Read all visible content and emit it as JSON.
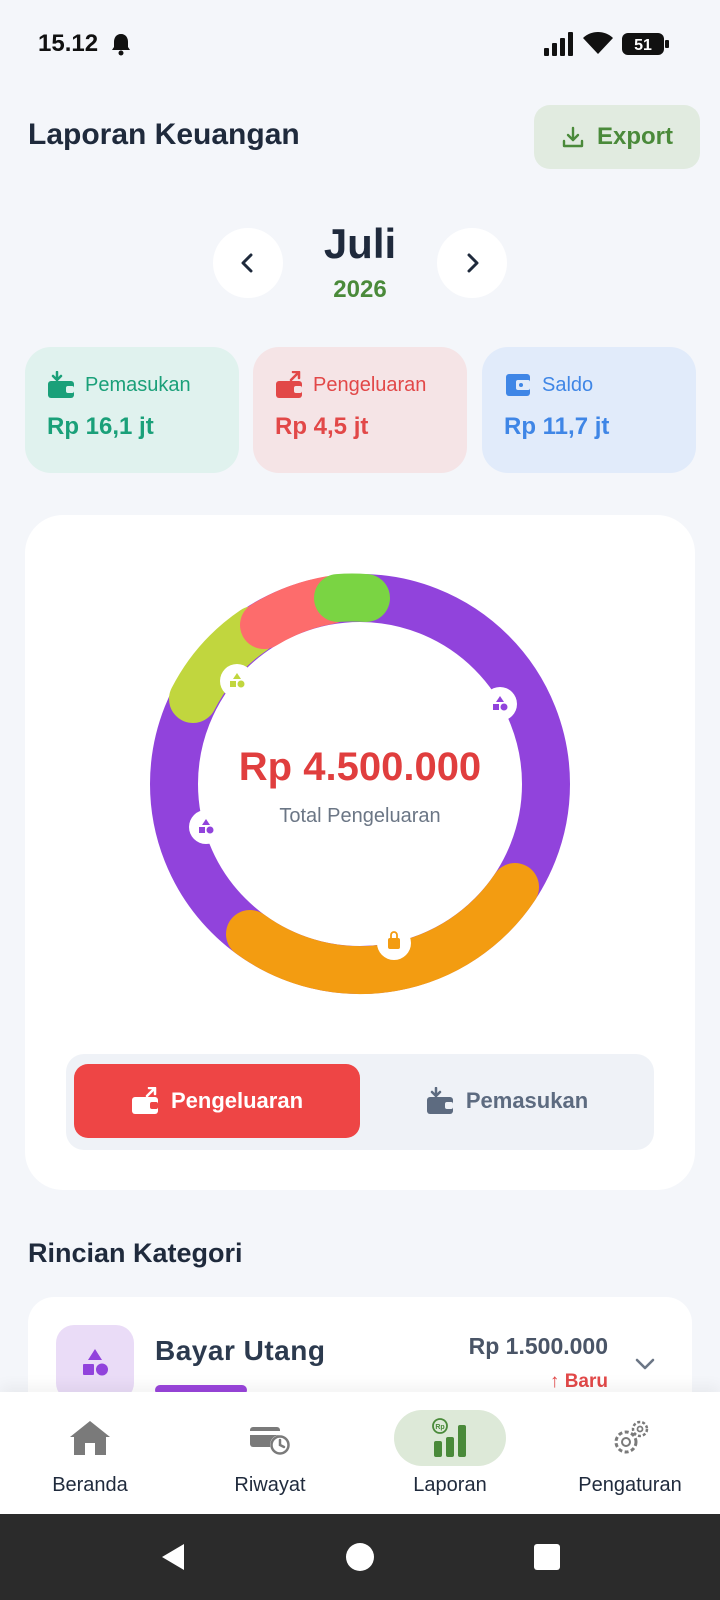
{
  "status_bar": {
    "time": "15.12",
    "battery": "51"
  },
  "header": {
    "title": "Laporan Keuangan",
    "export_label": "Export"
  },
  "period": {
    "month": "Juli",
    "year": "2026"
  },
  "summary": {
    "income": {
      "label": "Pemasukan",
      "amount": "Rp 16,1 jt",
      "color": "#1aa079"
    },
    "expense": {
      "label": "Pengeluaran",
      "amount": "Rp 4,5 jt",
      "color": "#e24848"
    },
    "balance": {
      "label": "Saldo",
      "amount": "Rp 11,7 jt",
      "color": "#3f86e6"
    }
  },
  "chart": {
    "total_amount": "Rp 4.500.000",
    "total_label": "Total Pengeluaran",
    "segment_colors": [
      "#9143dc",
      "#f39c11",
      "#9143dc",
      "#c1d63e",
      "#fd6c6c",
      "#7ad443"
    ],
    "segment_icons": [
      "shapes-icon",
      "shopping-bag-icon",
      "shapes-icon",
      "shapes-icon"
    ]
  },
  "toggle": {
    "active_label": "Pengeluaran",
    "inactive_label": "Pemasukan"
  },
  "section": {
    "title": "Rincian Kategori"
  },
  "categories": [
    {
      "name": "Bayar Utang",
      "amount": "Rp 1.500.000",
      "badge": "↑ Baru"
    }
  ],
  "bottom_nav": [
    {
      "label": "Beranda",
      "icon": "home-icon"
    },
    {
      "label": "Riwayat",
      "icon": "history-icon"
    },
    {
      "label": "Laporan",
      "icon": "report-icon"
    },
    {
      "label": "Pengaturan",
      "icon": "settings-icon"
    }
  ]
}
